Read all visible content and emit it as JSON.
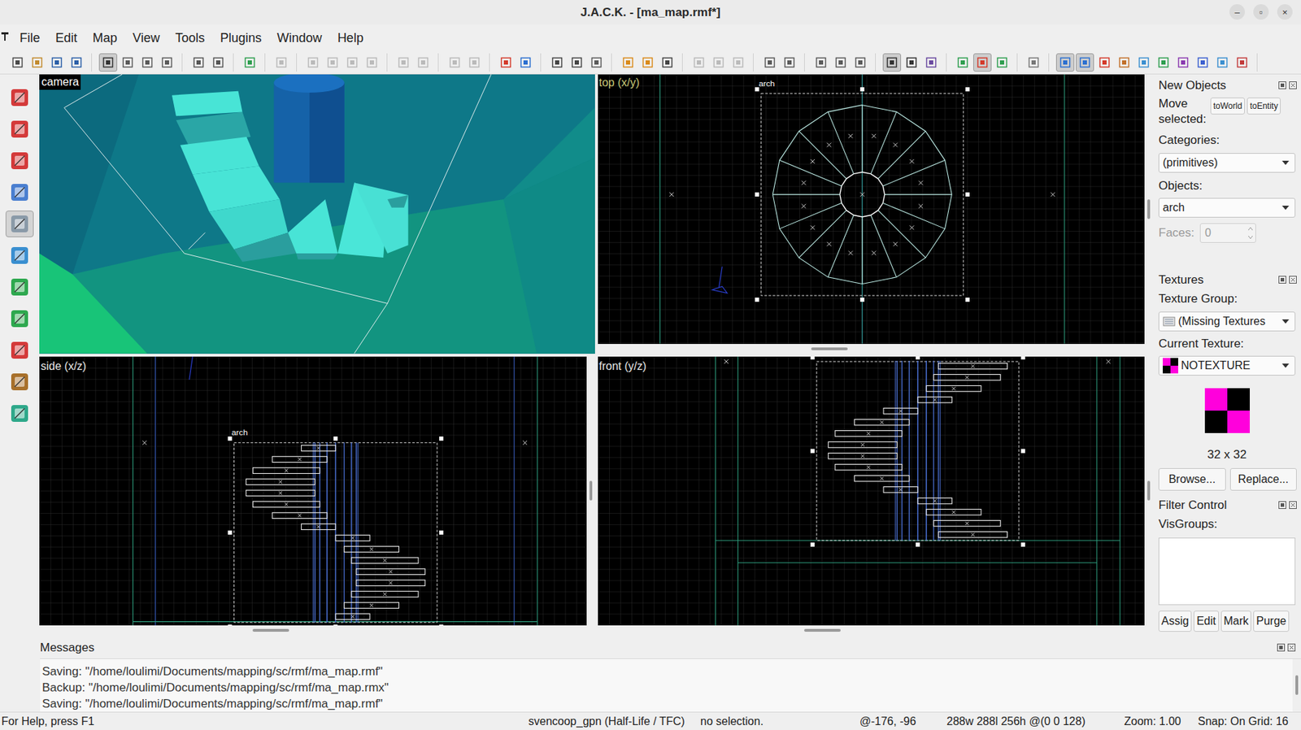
{
  "window": {
    "title": "J.A.C.K. - [ma_map.rmf*]",
    "controls": [
      "–",
      "▫",
      "×"
    ]
  },
  "menu": [
    "File",
    "Edit",
    "Map",
    "View",
    "Tools",
    "Plugins",
    "Window",
    "Help"
  ],
  "toolbar_buttons": [
    {
      "pressed": false,
      "disabled": false
    },
    {
      "pressed": false,
      "disabled": false
    },
    {
      "pressed": false,
      "disabled": false
    },
    {
      "pressed": false,
      "disabled": false
    },
    {
      "pressed": true,
      "disabled": false
    },
    {
      "pressed": false,
      "disabled": false
    },
    {
      "pressed": false,
      "disabled": false
    },
    {
      "pressed": false,
      "disabled": false
    },
    {
      "pressed": false,
      "disabled": false
    },
    {
      "pressed": false,
      "disabled": false
    },
    {
      "pressed": false,
      "disabled": false
    },
    {
      "pressed": false,
      "disabled": true
    },
    {
      "pressed": false,
      "disabled": true
    },
    {
      "pressed": false,
      "disabled": true
    },
    {
      "pressed": false,
      "disabled": true
    },
    {
      "pressed": false,
      "disabled": true
    },
    {
      "pressed": false,
      "disabled": true
    },
    {
      "pressed": false,
      "disabled": true
    },
    {
      "pressed": false,
      "disabled": true
    },
    {
      "pressed": false,
      "disabled": true
    },
    {
      "pressed": false,
      "disabled": false
    },
    {
      "pressed": false,
      "disabled": false
    },
    {
      "pressed": false,
      "disabled": false
    },
    {
      "pressed": false,
      "disabled": false
    },
    {
      "pressed": false,
      "disabled": false
    },
    {
      "pressed": false,
      "disabled": false
    },
    {
      "pressed": false,
      "disabled": false
    },
    {
      "pressed": false,
      "disabled": false
    },
    {
      "pressed": false,
      "disabled": true
    },
    {
      "pressed": false,
      "disabled": true
    },
    {
      "pressed": false,
      "disabled": true
    },
    {
      "pressed": false,
      "disabled": false
    },
    {
      "pressed": false,
      "disabled": false
    },
    {
      "pressed": false,
      "disabled": false
    },
    {
      "pressed": false,
      "disabled": false
    },
    {
      "pressed": false,
      "disabled": false
    },
    {
      "pressed": true,
      "disabled": false
    },
    {
      "pressed": false,
      "disabled": false
    },
    {
      "pressed": false,
      "disabled": false
    },
    {
      "pressed": false,
      "disabled": false
    },
    {
      "pressed": true,
      "disabled": false
    },
    {
      "pressed": false,
      "disabled": false
    },
    {
      "pressed": false,
      "disabled": false
    },
    {
      "pressed": true,
      "disabled": false
    },
    {
      "pressed": true,
      "disabled": false
    },
    {
      "pressed": false,
      "disabled": false
    },
    {
      "pressed": false,
      "disabled": false
    },
    {
      "pressed": false,
      "disabled": false
    },
    {
      "pressed": false,
      "disabled": false
    },
    {
      "pressed": false,
      "disabled": false
    },
    {
      "pressed": false,
      "disabled": false
    },
    {
      "pressed": false,
      "disabled": false
    },
    {
      "pressed": false,
      "disabled": false
    }
  ],
  "left_tools": [
    {
      "selected": false
    },
    {
      "selected": false
    },
    {
      "selected": false
    },
    {
      "selected": false
    },
    {
      "selected": true
    },
    {
      "selected": false
    },
    {
      "selected": false
    },
    {
      "selected": false
    },
    {
      "selected": false
    },
    {
      "selected": false
    },
    {
      "selected": false
    }
  ],
  "viewports": {
    "camera": {
      "label": "camera"
    },
    "top": {
      "label": "top (x/y)",
      "active": true,
      "object_label": "arch"
    },
    "side": {
      "label": "side (x/z)",
      "active": false,
      "object_label": "arch"
    },
    "front": {
      "label": "front (y/z)",
      "active": false
    }
  },
  "panel": {
    "new_objects": {
      "title": "New Objects",
      "move_label": "Move selected:",
      "move_buttons": [
        "toWorld",
        "toEntity"
      ],
      "categories_label": "Categories:",
      "category": "(primitives)",
      "objects_label": "Objects:",
      "object": "arch",
      "faces_label": "Faces:",
      "faces": "0",
      "faces_disabled": true
    },
    "textures": {
      "title": "Textures",
      "group_label": "Texture Group:",
      "group": "(Missing Textures",
      "current_label": "Current Texture:",
      "current": "NOTEXTURE",
      "size": "32 x 32",
      "buttons": [
        "Browse...",
        "Replace..."
      ]
    },
    "filter": {
      "title": "Filter Control",
      "visgroups_label": "VisGroups:",
      "visgroups": [],
      "buttons": [
        "Assig",
        "Edit",
        "Mark",
        "Purge"
      ]
    }
  },
  "messages": {
    "title": "Messages",
    "lines": [
      "Saving: \"/home/loulimi/Documents/mapping/sc/rmf/ma_map.rmf\"",
      "Backup: \"/home/loulimi/Documents/mapping/sc/rmf/ma_map.rmx\"",
      "Saving: \"/home/loulimi/Documents/mapping/sc/rmf/ma_map.rmf\""
    ]
  },
  "status_bar": {
    "help": "For Help, press F1",
    "game": "svencoop_gpn (Half-Life / TFC)",
    "selection": "no selection.",
    "cursor": "@-176, -96",
    "size": "288w 288l 256h @(0 0 128)",
    "zoom": "Zoom: 1.00",
    "snap": "Snap: On Grid: 16"
  }
}
